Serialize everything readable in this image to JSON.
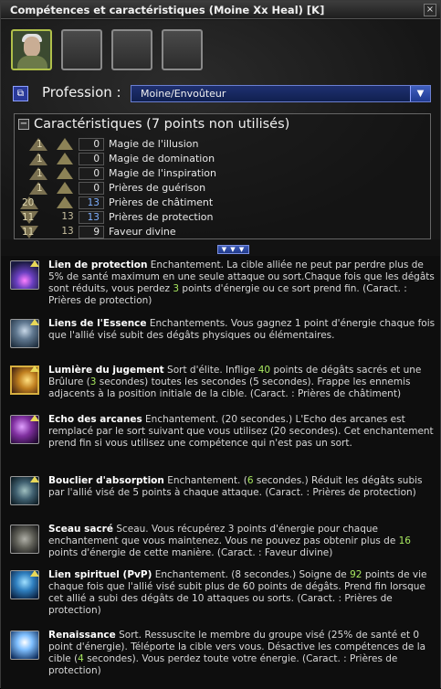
{
  "window": {
    "title": "Compétences et caractéristiques (Moine Xx Heal)  [K]",
    "close_label": "×"
  },
  "profession": {
    "label": "Profession :",
    "selected": "Moine/Envoûteur",
    "icon": "profession-icon"
  },
  "attributes": {
    "title": "Caractéristiques (7 points non utilisés)",
    "toggle": "−",
    "rows": [
      {
        "rank": "1",
        "base": "",
        "value": "0",
        "name": "Magie de l'illusion"
      },
      {
        "rank": "1",
        "base": "",
        "value": "0",
        "name": "Magie de domination"
      },
      {
        "rank": "1",
        "base": "",
        "value": "0",
        "name": "Magie de l'inspiration"
      },
      {
        "rank": "1",
        "base": "",
        "value": "0",
        "name": "Prières de guérison"
      },
      {
        "rank": "20",
        "base": "",
        "value": "13",
        "name": "Prières de châtiment"
      },
      {
        "rank": "11",
        "base": "13",
        "value": "13",
        "name": "Prières de protection"
      },
      {
        "rank": "11",
        "base": "13",
        "value": "9",
        "name": "Faveur divine"
      }
    ]
  },
  "expand_label": "▼ ▼ ▼",
  "skills": [
    {
      "name": "Lien de protection",
      "desc_parts": [
        {
          "t": " Enchantement. La cible alliée ne peut par perdre plus de 5% de santé maximum en une seule attaque ou sort.Chaque fois que les dégâts sont réduits, vous perdez ",
          "c": ""
        },
        {
          "t": "3",
          "c": "hl"
        },
        {
          "t": " points d'énergie ou ce sort prend fin. (Caract. : Prières de protection)",
          "c": ""
        }
      ]
    },
    {
      "name": "Liens de l'Essence",
      "desc_parts": [
        {
          "t": " Enchantements. Vous gagnez 1 point d'énergie chaque fois que l'allié visé subit des dégâts physiques ou élémentaires.",
          "c": ""
        }
      ]
    },
    {
      "name": "Lumière du jugement",
      "desc_parts": [
        {
          "t": " Sort d'élite. Inflige ",
          "c": ""
        },
        {
          "t": "40",
          "c": "hl"
        },
        {
          "t": " points de dégâts sacrés et une Brûlure (",
          "c": ""
        },
        {
          "t": "3",
          "c": "hl"
        },
        {
          "t": " secondes) toutes les secondes (5 secondes). Frappe les ennemis adjacents à la position initiale de la cible. (Caract. : Prières de châtiment)",
          "c": ""
        }
      ]
    },
    {
      "name": "Echo des arcanes",
      "desc_parts": [
        {
          "t": " Enchantement. (20 secondes.) L'Echo des arcanes est remplacé par le sort suivant que vous utilisez (20 secondes). Cet enchantement prend fin si vous utilisez une compétence qui n'est pas un sort.",
          "c": ""
        }
      ]
    },
    {
      "name": "Bouclier d'absorption",
      "desc_parts": [
        {
          "t": " Enchantement. (",
          "c": ""
        },
        {
          "t": "6",
          "c": "hl"
        },
        {
          "t": " secondes.) Réduit les dégâts subis par l'allié visé de 5 points à chaque attaque. (Caract. : Prières de protection)",
          "c": ""
        }
      ]
    },
    {
      "name": "Sceau sacré",
      "desc_parts": [
        {
          "t": " Sceau. Vous récupérez 3 points d'énergie pour chaque enchantement que vous maintenez. Vous ne pouvez pas obtenir plus de ",
          "c": ""
        },
        {
          "t": "16",
          "c": "hl"
        },
        {
          "t": " points d'énergie de cette manière. (Caract. : Faveur divine)",
          "c": ""
        }
      ]
    },
    {
      "name": "Lien spirituel (PvP)",
      "desc_parts": [
        {
          "t": " Enchantement. (8 secondes.) Soigne de ",
          "c": ""
        },
        {
          "t": "92",
          "c": "hl"
        },
        {
          "t": " points de vie chaque fois que l'allié visé subit plus de 60 points de dégâts. Prend fin lorsque cet allié a subi des dégâts de 10 attaques ou sorts. (Caract. : Prières de protection)",
          "c": ""
        }
      ]
    },
    {
      "name": "Renaissance",
      "desc_parts": [
        {
          "t": " Sort. Ressuscite le membre du groupe visé (25% de santé et 0 point d'énergie). Téléporte la cible vers vous. Désactive les compétences de la cible (",
          "c": ""
        },
        {
          "t": "4",
          "c": "hl"
        },
        {
          "t": " secondes). Vous perdez toute votre énergie. (Caract. : Prières de protection)",
          "c": ""
        }
      ]
    }
  ],
  "colors": {
    "accent_blue": "#2a3f9a",
    "highlight_green": "#a8e860",
    "elite_gold": "#d8b040"
  }
}
